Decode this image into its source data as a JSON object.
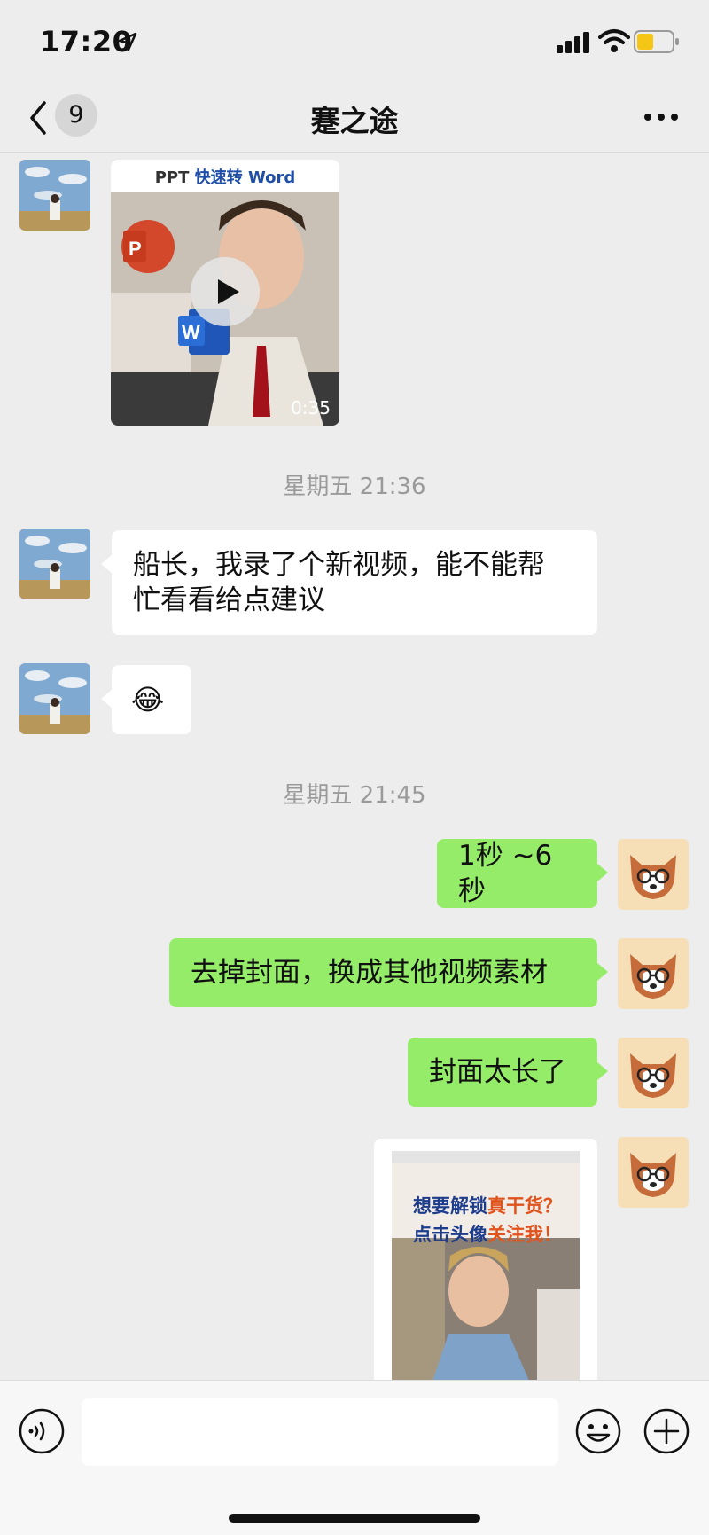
{
  "status_bar": {
    "time": "17:20",
    "icons": [
      "location-arrow-icon",
      "signal-bars-icon",
      "wifi-icon",
      "battery-icon"
    ],
    "battery_color": "#f5c518"
  },
  "nav": {
    "back_icon": "chevron-left-icon",
    "unread_count": "9",
    "title": "蹇之途",
    "more_icon": "more-dots-icon"
  },
  "messages": [
    {
      "from": "other",
      "type": "video",
      "caption_prefix": "PPT",
      "caption_main": "快速转 Word",
      "duration": "0:35"
    },
    {
      "type": "timestamp",
      "text": "星期五 21:36"
    },
    {
      "from": "other",
      "type": "text",
      "lines": [
        "船长，我录了个新视频，能不能帮",
        "忙看看给点建议"
      ]
    },
    {
      "from": "other",
      "type": "emoji",
      "emoji": "😂"
    },
    {
      "type": "timestamp",
      "text": "星期五 21:45"
    },
    {
      "from": "me",
      "type": "text",
      "text": "1秒 ~6秒"
    },
    {
      "from": "me",
      "type": "text",
      "text": "去掉封面，换成其他视频素材"
    },
    {
      "from": "me",
      "type": "text",
      "text": "封面太长了"
    },
    {
      "from": "me",
      "type": "image",
      "line1_a": "想要解锁",
      "line1_b": "真干货？",
      "line2_a": "点击头像",
      "line2_b": "关注我！"
    }
  ],
  "input_bar": {
    "placeholder": "",
    "icons": [
      "voice-icon",
      "emoji-face-icon",
      "plus-icon"
    ]
  },
  "colors": {
    "background": "#ededed",
    "bubble_out": "#95ec69",
    "bubble_in": "#ffffff",
    "accent_navy": "#1e3c8c",
    "accent_orange": "#e0531d"
  }
}
